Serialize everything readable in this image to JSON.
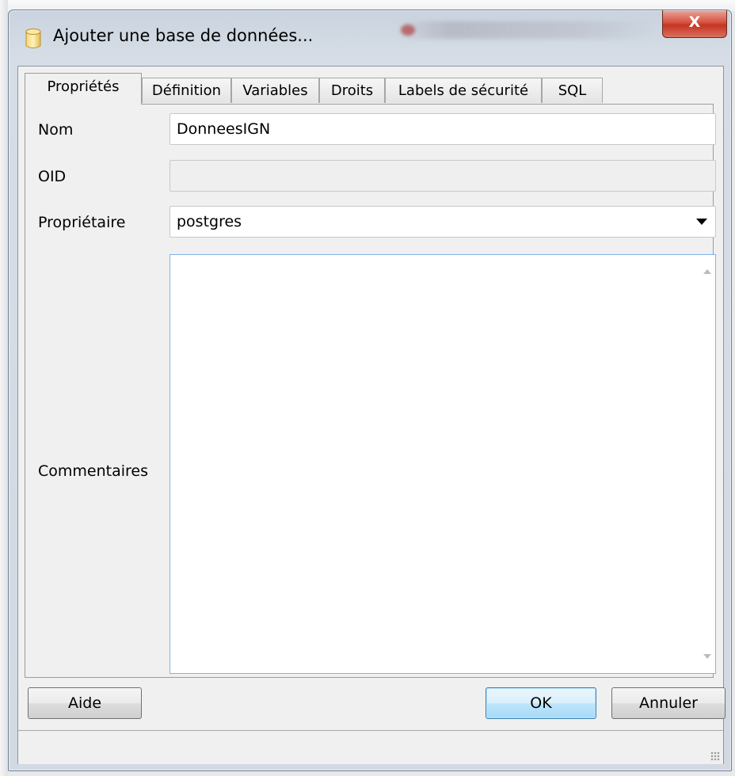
{
  "window": {
    "title": "Ajouter une base de données...",
    "close_label": "X"
  },
  "tabs": [
    {
      "label": "Propriétés",
      "active": true
    },
    {
      "label": "Définition",
      "active": false
    },
    {
      "label": "Variables",
      "active": false
    },
    {
      "label": "Droits",
      "active": false
    },
    {
      "label": "Labels de sécurité",
      "active": false
    },
    {
      "label": "SQL",
      "active": false
    }
  ],
  "form": {
    "nom": {
      "label": "Nom",
      "value": "DonneesIGN"
    },
    "oid": {
      "label": "OID",
      "value": ""
    },
    "proprietaire": {
      "label": "Propriétaire",
      "value": "postgres"
    },
    "commentaires": {
      "label": "Commentaires",
      "value": ""
    }
  },
  "buttons": {
    "aide": "Aide",
    "ok": "OK",
    "annuler": "Annuler"
  },
  "icons": {
    "app": "database-icon",
    "close": "close-icon",
    "dropdown": "chevron-down-icon",
    "resize": "resize-grip-icon"
  },
  "colors": {
    "close_button": "#c43521",
    "default_button": "#3c7fb1",
    "window_frame": "#d2d9e2"
  }
}
